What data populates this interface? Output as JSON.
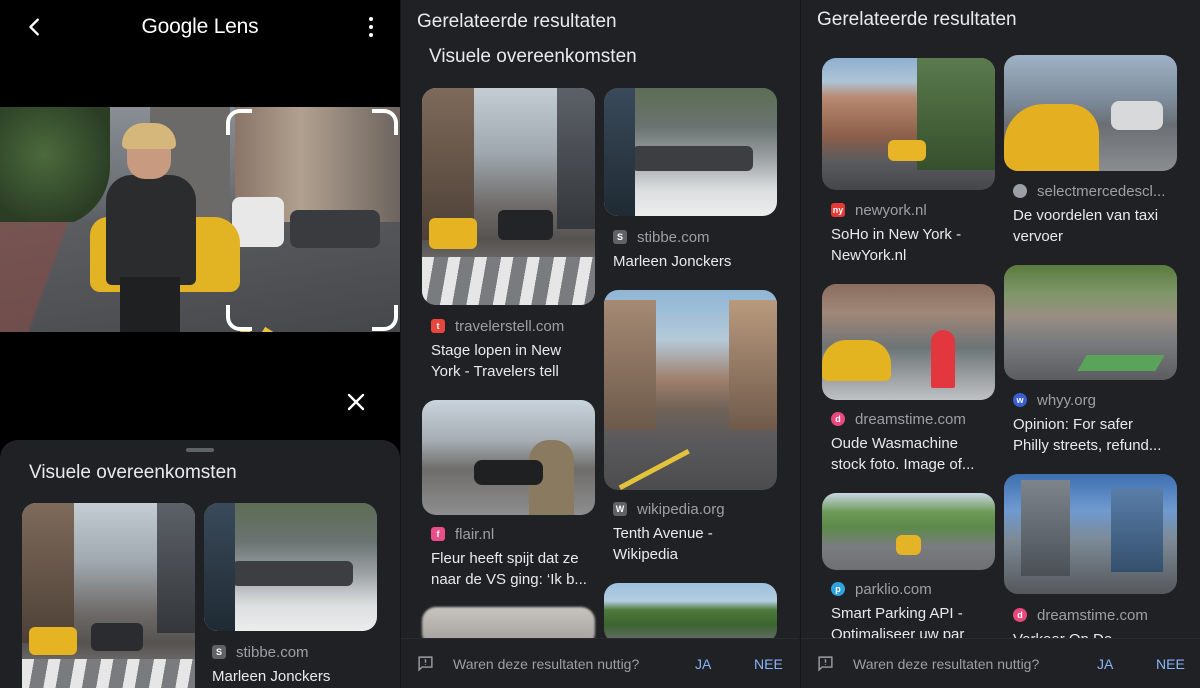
{
  "panel1": {
    "app_title": "Google Lens",
    "sheet_title": "Visuele overeenkomsten",
    "results": [
      {
        "source": "",
        "title": ""
      },
      {
        "source": "stibbe.com",
        "title": "Marleen Jonckers"
      }
    ]
  },
  "panel2": {
    "header": "Gerelateerde resultaten",
    "section_title": "Visuele overeenkomsten",
    "results": [
      {
        "source": "travelerstell.com",
        "title": "Stage lopen in New\nYork - Travelers tell",
        "favicon_color": "#e8453c"
      },
      {
        "source": "stibbe.com",
        "title": "Marleen Jonckers",
        "favicon_color": "#5f6368"
      },
      {
        "source": "wikipedia.org",
        "title": "Tenth Avenue -\nWikipedia",
        "favicon_color": "#5f6368"
      },
      {
        "source": "flair.nl",
        "title": "Fleur heeft spijt dat ze\nnaar de VS ging: ‘Ik b...",
        "favicon_color": "#e84f8a"
      }
    ],
    "feedback": {
      "question": "Waren deze resultaten nuttig?",
      "yes": "JA",
      "no": "NEE"
    }
  },
  "panel3": {
    "header": "Gerelateerde resultaten",
    "results": [
      {
        "source": "newyork.nl",
        "title": "SoHo in New York -\nNewYork.nl",
        "favicon_color": "#e53935"
      },
      {
        "source": "selectmercedescl...",
        "title": "De voordelen van taxi\nvervoer",
        "favicon_color": "#9aa0a6"
      },
      {
        "source": "dreamstime.com",
        "title": "Oude Wasmachine\nstock foto. Image of...",
        "favicon_color": "#e8497a"
      },
      {
        "source": "whyy.org",
        "title": "Opinion: For safer\nPhilly streets, refund...",
        "favicon_color": "#3a5fcd"
      },
      {
        "source": "parklio.com",
        "title": "Smart Parking API -\nOptimaliseer uw par",
        "favicon_color": "#2fa3e0"
      },
      {
        "source": "dreamstime.com",
        "title": "Verkeer Op De...",
        "favicon_color": "#e8497a"
      }
    ],
    "feedback": {
      "question": "Waren deze resultaten nuttig?",
      "yes": "JA",
      "no": "NEE"
    }
  },
  "colors": {
    "background": "#202124",
    "link": "#8ab4f8",
    "secondary_text": "#9aa0a6",
    "primary_text": "#e8eaed"
  },
  "icons": [
    "back-arrow-icon",
    "more-vert-icon",
    "close-icon",
    "feedback-icon"
  ]
}
